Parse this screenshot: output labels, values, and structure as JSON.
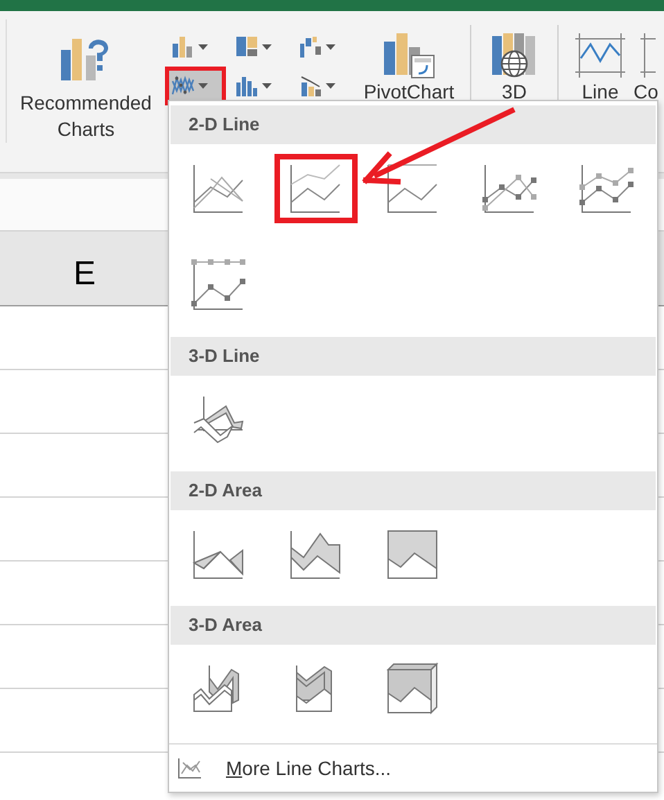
{
  "ribbon": {
    "recommended_charts": {
      "label": "Recommended Charts"
    },
    "chart_buttons": [
      {
        "kind": "column",
        "open": false,
        "highlighted": false
      },
      {
        "kind": "hierarchy",
        "open": false,
        "highlighted": false
      },
      {
        "kind": "waterfall",
        "open": false,
        "highlighted": false
      },
      {
        "kind": "line",
        "open": true,
        "highlighted": true
      },
      {
        "kind": "statistic",
        "open": false,
        "highlighted": false
      },
      {
        "kind": "combo",
        "open": false,
        "highlighted": false
      }
    ],
    "pivot_chart": {
      "label": "PivotChart"
    },
    "map_3d": {
      "label": "3D"
    },
    "sparkline_line": {
      "label": "Line"
    },
    "column_cut": {
      "label": "Co"
    }
  },
  "sheet": {
    "column_header": "E"
  },
  "dropdown": {
    "sections": [
      {
        "title": "2-D Line",
        "items": [
          {
            "kind": "line",
            "highlighted": false
          },
          {
            "kind": "stacked-line",
            "highlighted": true
          },
          {
            "kind": "percent-line",
            "highlighted": false
          },
          {
            "kind": "line-markers",
            "highlighted": false
          },
          {
            "kind": "stacked-line-markers",
            "highlighted": false
          },
          {
            "kind": "percent-line-markers",
            "highlighted": false
          }
        ]
      },
      {
        "title": "3-D Line",
        "items": [
          {
            "kind": "line-3d",
            "highlighted": false
          }
        ]
      },
      {
        "title": "2-D Area",
        "items": [
          {
            "kind": "area",
            "highlighted": false
          },
          {
            "kind": "stacked-area",
            "highlighted": false
          },
          {
            "kind": "percent-area",
            "highlighted": false
          }
        ]
      },
      {
        "title": "3-D Area",
        "items": [
          {
            "kind": "area-3d",
            "highlighted": false
          },
          {
            "kind": "stacked-area-3d",
            "highlighted": false
          },
          {
            "kind": "percent-area-3d",
            "highlighted": false
          }
        ]
      }
    ],
    "footer": {
      "label": "More Line Charts..."
    }
  },
  "annotation": {
    "arrow": true
  }
}
